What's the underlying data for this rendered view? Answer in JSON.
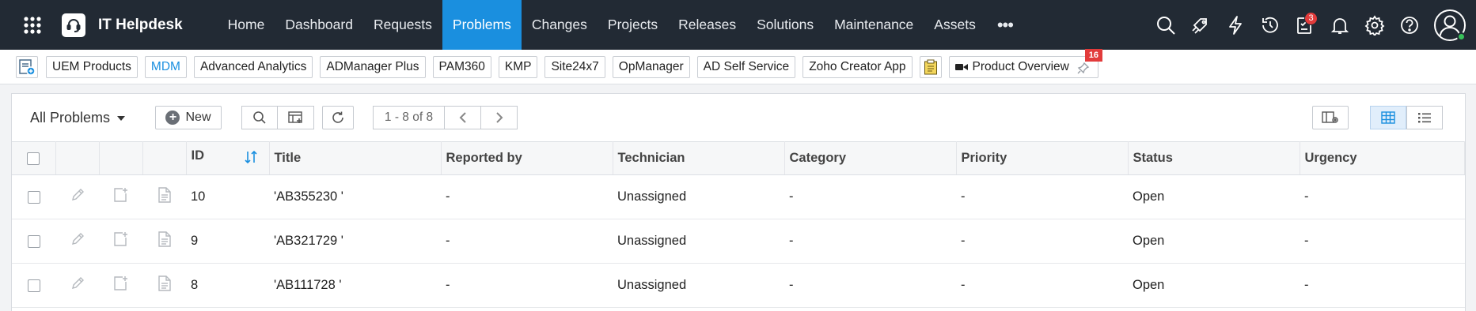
{
  "header": {
    "app_title": "IT Helpdesk",
    "nav": [
      "Home",
      "Dashboard",
      "Requests",
      "Problems",
      "Changes",
      "Projects",
      "Releases",
      "Solutions",
      "Maintenance",
      "Assets"
    ],
    "active_nav": "Problems",
    "more_label": "•••",
    "tasks_badge": "3"
  },
  "quicklinks": {
    "items": [
      "UEM Products",
      "MDM",
      "Advanced Analytics",
      "ADManager Plus",
      "PAM360",
      "KMP",
      "Site24x7",
      "OpManager",
      "AD Self Service",
      "Zoho Creator App"
    ],
    "product_overview": "Product Overview",
    "product_badge": "16"
  },
  "toolbar": {
    "view_label": "All Problems",
    "new_label": "New",
    "page_info": "1 - 8 of 8"
  },
  "table": {
    "columns": [
      "ID",
      "Title",
      "Reported by",
      "Technician",
      "Category",
      "Priority",
      "Status",
      "Urgency"
    ],
    "rows": [
      [
        "10",
        "'AB355230 '",
        "-",
        "Unassigned",
        "-",
        "-",
        "Open",
        "-"
      ],
      [
        "9",
        "'AB321729 '",
        "-",
        "Unassigned",
        "-",
        "-",
        "Open",
        "-"
      ],
      [
        "8",
        "'AB111728 '",
        "-",
        "Unassigned",
        "-",
        "-",
        "Open",
        "-"
      ]
    ]
  },
  "colors": {
    "topbar": "#222a34",
    "accent": "#1a8fdf",
    "badge": "#e23b3b"
  }
}
